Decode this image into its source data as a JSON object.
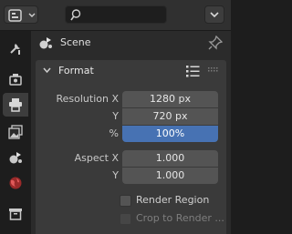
{
  "header": {
    "editor_icon": "properties-editor-icon",
    "search_placeholder": "",
    "filter_icon": "chevron-down-icon"
  },
  "tabs": [
    {
      "icon": "tool-icon"
    },
    {
      "icon": "render-icon"
    },
    {
      "icon": "output-icon",
      "active": true
    },
    {
      "icon": "view-layer-icon"
    },
    {
      "icon": "scene-icon"
    },
    {
      "icon": "world-icon"
    },
    {
      "icon": "collection-icon"
    }
  ],
  "context": {
    "label": "Scene"
  },
  "panel": {
    "title": "Format",
    "rows": {
      "resolution_x": {
        "label": "Resolution X",
        "value": "1280 px"
      },
      "resolution_y": {
        "label": "Y",
        "value": "720 px"
      },
      "resolution_pct": {
        "label": "%",
        "value": "100%"
      },
      "aspect_x": {
        "label": "Aspect X",
        "value": "1.000"
      },
      "aspect_y": {
        "label": "Y",
        "value": "1.000"
      }
    },
    "render_region": {
      "label": "Render Region",
      "checked": false
    },
    "crop_to_render": {
      "label": "Crop to Render ...",
      "checked": false,
      "enabled": false
    }
  },
  "colors": {
    "accent_slider": "#4772b3",
    "background": "#1d1d1d",
    "panel": "#3a3a3a",
    "field": "#545454"
  }
}
